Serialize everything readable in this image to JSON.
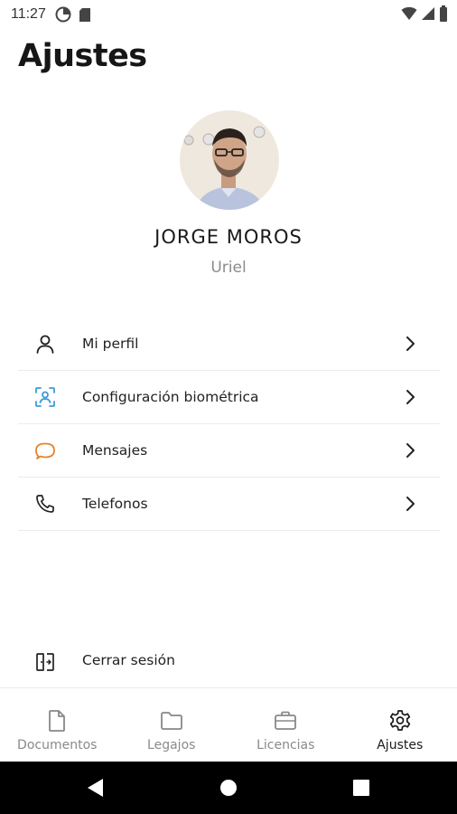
{
  "status_bar": {
    "time": "11:27"
  },
  "page": {
    "title": "Ajustes"
  },
  "profile": {
    "name": "JORGE MOROS",
    "subtitle": "Uriel"
  },
  "menu": [
    {
      "label": "Mi perfil",
      "icon": "user-icon"
    },
    {
      "label": "Configuración biométrica",
      "icon": "face-scan-icon"
    },
    {
      "label": "Mensajes",
      "icon": "chat-bubble-icon"
    },
    {
      "label": "Telefonos",
      "icon": "phone-icon"
    }
  ],
  "logout": {
    "label": "Cerrar sesión",
    "icon": "logout-icon"
  },
  "bottom_nav": [
    {
      "label": "Documentos",
      "icon": "document-icon"
    },
    {
      "label": "Legajos",
      "icon": "folder-icon"
    },
    {
      "label": "Licencias",
      "icon": "briefcase-icon"
    },
    {
      "label": "Ajustes",
      "icon": "gear-icon",
      "active": true
    }
  ],
  "colors": {
    "biometric_icon": "#3b9bd9",
    "messages_icon": "#e8822a",
    "text": "#1a1a1a",
    "muted": "#8a8a8a"
  }
}
